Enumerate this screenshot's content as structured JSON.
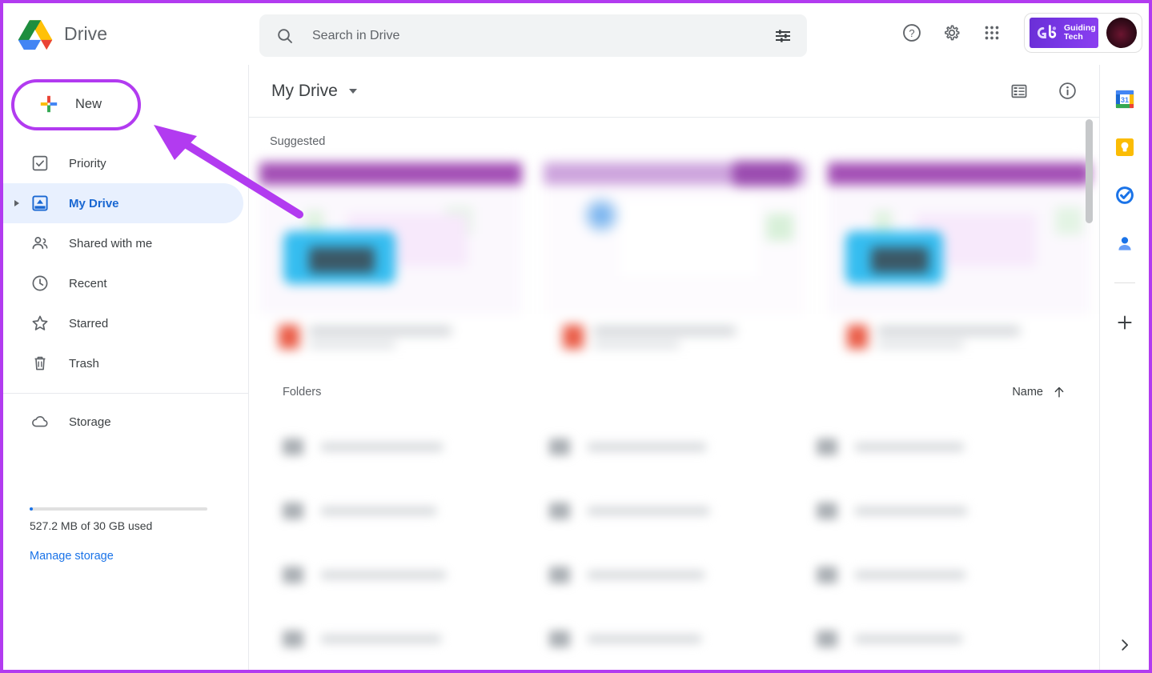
{
  "app": {
    "title": "Drive",
    "logo_icon": "google-drive-logo",
    "accent_purple": "#b23bf0",
    "brand_blue": "#1a73e8"
  },
  "header": {
    "search": {
      "placeholder": "Search in Drive",
      "value": "",
      "search_icon": "search-icon",
      "filter_icon": "tune-icon"
    },
    "help_icon": "help-circle-icon",
    "settings_icon": "gear-icon",
    "apps_icon": "apps-grid-icon",
    "workspace_badge": {
      "line1": "Guiding",
      "line2": "Tech",
      "mark": "gt-logo"
    },
    "avatar_icon": "user-avatar"
  },
  "sidebar": {
    "new_button": {
      "label": "New",
      "icon": "plus-icon",
      "highlighted": true
    },
    "items": [
      {
        "label": "Priority",
        "icon": "check-box-icon",
        "active": false,
        "expandable": false
      },
      {
        "label": "My Drive",
        "icon": "my-drive-icon",
        "active": true,
        "expandable": true
      },
      {
        "label": "Shared with me",
        "icon": "people-icon",
        "active": false,
        "expandable": false
      },
      {
        "label": "Recent",
        "icon": "clock-icon",
        "active": false,
        "expandable": false
      },
      {
        "label": "Starred",
        "icon": "star-icon",
        "active": false,
        "expandable": false
      },
      {
        "label": "Trash",
        "icon": "trash-icon",
        "active": false,
        "expandable": false
      }
    ],
    "storage": {
      "label": "Storage",
      "icon": "cloud-icon",
      "usage_text": "527.2 MB of 30 GB used",
      "used_percent": 1.7,
      "manage_link": "Manage storage"
    }
  },
  "main": {
    "breadcrumb": "My Drive",
    "breadcrumb_caret": "chevron-down-icon",
    "list_view_icon": "list-view-icon",
    "details_icon": "info-circle-icon",
    "suggested": {
      "title": "Suggested",
      "cards": [
        {
          "blurred": true,
          "file_icon": "pdf-icon"
        },
        {
          "blurred": true,
          "file_icon": "pdf-icon"
        },
        {
          "blurred": true,
          "file_icon": "pdf-icon"
        }
      ]
    },
    "folders": {
      "title": "Folders",
      "sort": {
        "label": "Name",
        "direction_icon": "arrow-up-icon"
      },
      "items": [
        {
          "blurred": true,
          "name_width": 152
        },
        {
          "blurred": true,
          "name_width": 148
        },
        {
          "blurred": true,
          "name_width": 136
        },
        {
          "blurred": true,
          "name_width": 144
        },
        {
          "blurred": true,
          "name_width": 152
        },
        {
          "blurred": true,
          "name_width": 140
        },
        {
          "blurred": true,
          "name_width": 156
        },
        {
          "blurred": true,
          "name_width": 146
        },
        {
          "blurred": true,
          "name_width": 138
        },
        {
          "blurred": true,
          "name_width": 150
        },
        {
          "blurred": true,
          "name_width": 142
        },
        {
          "blurred": true,
          "name_width": 134
        }
      ]
    }
  },
  "right_rail": {
    "items": [
      {
        "label": "Calendar",
        "icon": "google-calendar-icon"
      },
      {
        "label": "Keep",
        "icon": "google-keep-icon"
      },
      {
        "label": "Tasks",
        "icon": "google-tasks-icon"
      },
      {
        "label": "Contacts",
        "icon": "google-contacts-icon"
      }
    ],
    "add_icon": "plus-icon",
    "expand_icon": "chevron-right-icon"
  },
  "annotation": {
    "border_color": "#b23bf0",
    "arrow_color": "#b23bf0",
    "arrow_target": "new-button"
  }
}
